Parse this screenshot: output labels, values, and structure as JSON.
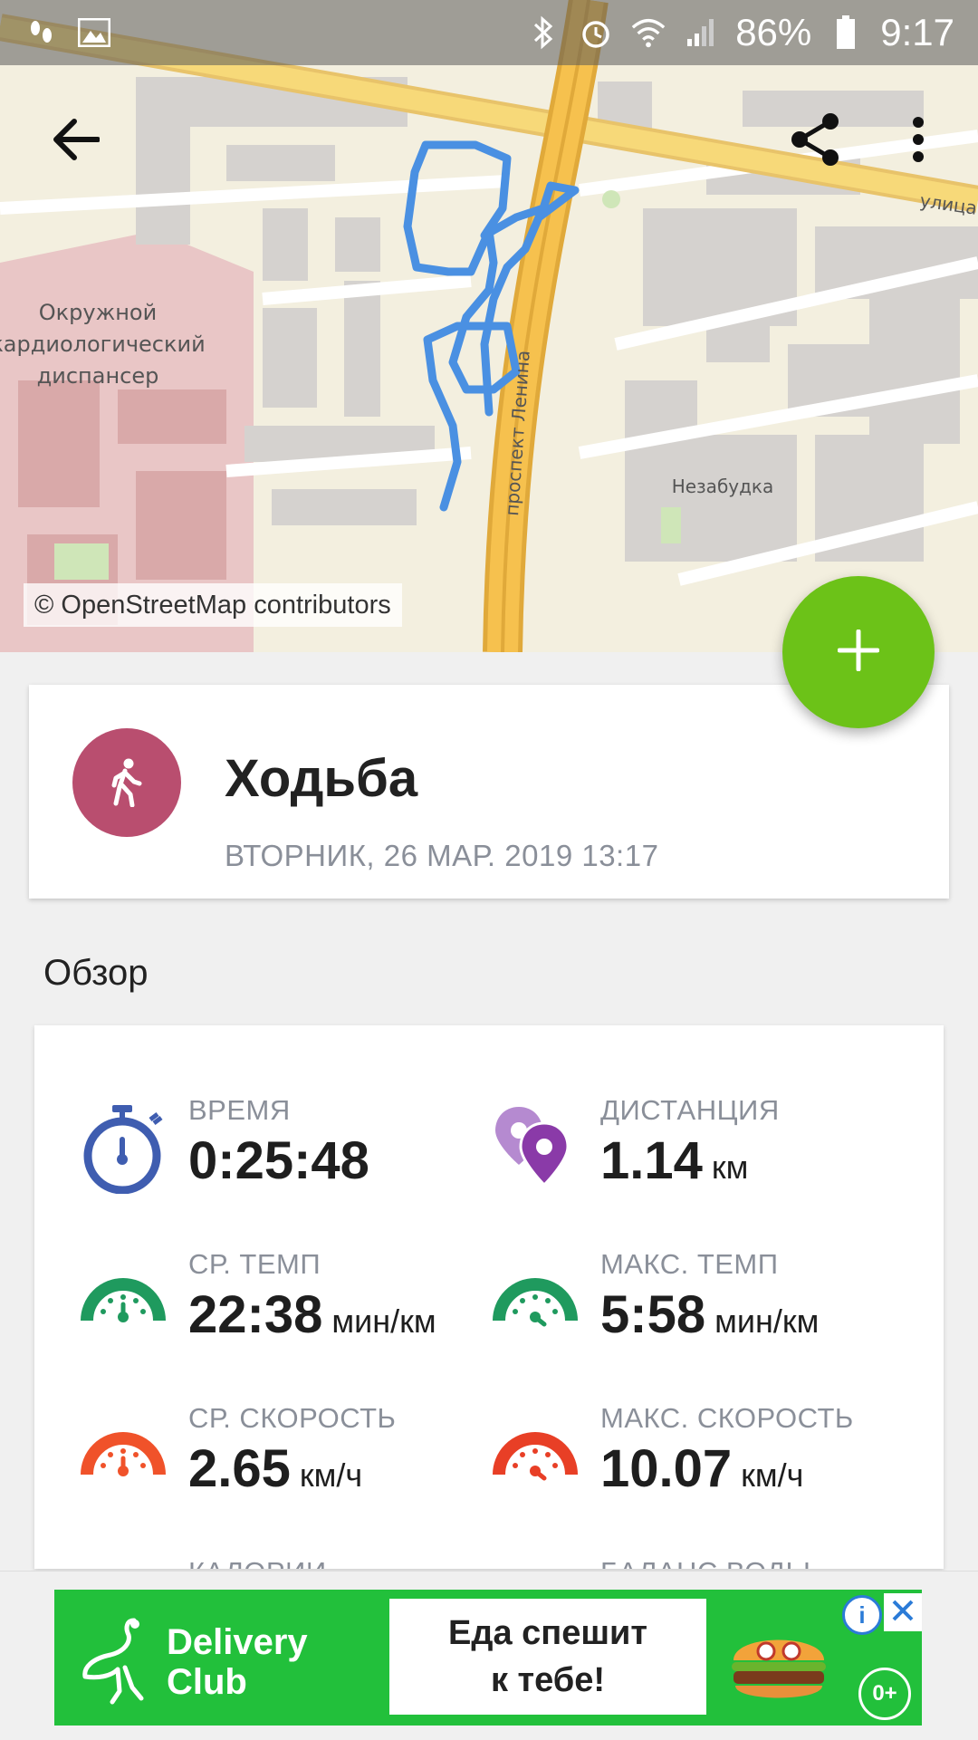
{
  "status_bar": {
    "battery_percent": "86%",
    "time": "9:17",
    "icons": [
      "footsteps-icon",
      "image-icon",
      "bluetooth-icon",
      "alarm-icon",
      "wifi-icon",
      "signal-icon",
      "battery-icon"
    ]
  },
  "map": {
    "district_label_line1": "Окружной",
    "district_label_line2": "кардиологический",
    "district_label_line3": "диспансер",
    "street_label": "проспект Ленина",
    "street_label_top": "улица",
    "place_label": "Незабудка",
    "attribution": "© OpenStreetMap contributors",
    "route_color": "#4a90e2"
  },
  "toolbar": {
    "back_icon": "arrow-left-icon",
    "share_icon": "share-icon",
    "menu_icon": "more-vert-icon"
  },
  "fab": {
    "icon": "plus-icon",
    "color": "#6cc218"
  },
  "activity": {
    "title": "Ходьба",
    "date": "ВТОРНИК, 26 МАР. 2019 13:17",
    "icon": "walking-icon",
    "icon_color": "#b94e6f"
  },
  "overview": {
    "heading": "Обзор",
    "stats": [
      {
        "label": "ВРЕМЯ",
        "value": "0:25:48",
        "unit": "",
        "icon": "stopwatch-icon"
      },
      {
        "label": "ДИСТАНЦИЯ",
        "value": "1.14",
        "unit": "км",
        "icon": "map-pins-icon"
      },
      {
        "label": "СР. ТЕМП",
        "value": "22:38",
        "unit": "мин/км",
        "icon": "gauge-green-icon"
      },
      {
        "label": "МАКС. ТЕМП",
        "value": "5:58",
        "unit": "мин/км",
        "icon": "gauge-green-icon"
      },
      {
        "label": "СР. СКОРОСТЬ",
        "value": "2.65",
        "unit": "км/ч",
        "icon": "gauge-orange-icon"
      },
      {
        "label": "МАКС. СКОРОСТЬ",
        "value": "10.07",
        "unit": "км/ч",
        "icon": "gauge-red-icon"
      },
      {
        "label": "КАЛОРИИ",
        "value": "",
        "unit": "",
        "icon": "flame-icon"
      },
      {
        "label": "БАЛАНС ВОДЫ",
        "value": "",
        "unit": "",
        "icon": "water-drop-icon"
      }
    ]
  },
  "ad": {
    "brand_line1": "Delivery",
    "brand_line2": "Club",
    "slogan_line1": "Еда спешит",
    "slogan_line2": "к тебе!",
    "age_rating": "0+",
    "info_label": "i",
    "background_color": "#22c03b"
  }
}
